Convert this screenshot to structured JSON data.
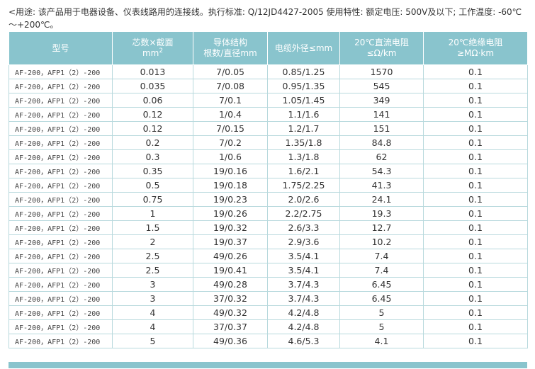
{
  "intro_text": "<用途: 该产品用于电器设备、仪表线路用的连接线。执行标准: Q/12JD4427-2005 使用特性: 额定电压: 500V及以下; 工作温度: -60℃～+200℃。",
  "table": {
    "headers": [
      {
        "line1": "型号",
        "line2": ""
      },
      {
        "line1": "芯数×截面",
        "line2": "mm",
        "sup": "2"
      },
      {
        "line1": "导体结构",
        "line2": "根数/直径mm"
      },
      {
        "line1": "电缆外径≤mm",
        "line2": ""
      },
      {
        "line1": "20℃直流电阻",
        "line2": "≤Ω/km"
      },
      {
        "line1": "20℃绝缘电阻",
        "line2": "≥MΩ·km"
      }
    ],
    "rows": [
      [
        "AF-200，AFP1（2）-200",
        "0.013",
        "7/0.05",
        "0.85/1.25",
        "1570",
        "0.1"
      ],
      [
        "AF-200，AFP1（2）-200",
        "0.035",
        "7/0.08",
        "0.95/1.35",
        "545",
        "0.1"
      ],
      [
        "AF-200，AFP1（2）-200",
        "0.06",
        "7/0.1",
        "1.05/1.45",
        "349",
        "0.1"
      ],
      [
        "AF-200，AFP1（2）-200",
        "0.12",
        "1/0.4",
        "1.1/1.6",
        "141",
        "0.1"
      ],
      [
        "AF-200，AFP1（2）-200",
        "0.12",
        "7/0.15",
        "1.2/1.7",
        "151",
        "0.1"
      ],
      [
        "AF-200，AFP1（2）-200",
        "0.2",
        "7/0.2",
        "1.35/1.8",
        "84.8",
        "0.1"
      ],
      [
        "AF-200，AFP1（2）-200",
        "0.3",
        "1/0.6",
        "1.3/1.8",
        "62",
        "0.1"
      ],
      [
        "AF-200，AFP1（2）-200",
        "0.35",
        "19/0.16",
        "1.6/2.1",
        "54.3",
        "0.1"
      ],
      [
        "AF-200，AFP1（2）-200",
        "0.5",
        "19/0.18",
        "1.75/2.25",
        "41.3",
        "0.1"
      ],
      [
        "AF-200，AFP1（2）-200",
        "0.75",
        "19/0.23",
        "2.0/2.6",
        "24.1",
        "0.1"
      ],
      [
        "AF-200，AFP1（2）-200",
        "1",
        "19/0.26",
        "2.2/2.75",
        "19.3",
        "0.1"
      ],
      [
        "AF-200，AFP1（2）-200",
        "1.5",
        "19/0.32",
        "2.6/3.3",
        "12.7",
        "0.1"
      ],
      [
        "AF-200，AFP1（2）-200",
        "2",
        "19/0.37",
        "2.9/3.6",
        "10.2",
        "0.1"
      ],
      [
        "AF-200，AFP1（2）-200",
        "2.5",
        "49/0.26",
        "3.5/4.1",
        "7.4",
        "0.1"
      ],
      [
        "AF-200，AFP1（2）-200",
        "2.5",
        "19/0.41",
        "3.5/4.1",
        "7.4",
        "0.1"
      ],
      [
        "AF-200，AFP1（2）-200",
        "3",
        "49/0.28",
        "3.7/4.3",
        "6.45",
        "0.1"
      ],
      [
        "AF-200，AFP1（2）-200",
        "3",
        "37/0.32",
        "3.7/4.3",
        "6.45",
        "0.1"
      ],
      [
        "AF-200，AFP1（2）-200",
        "4",
        "49/0.32",
        "4.2/4.8",
        "5",
        "0.1"
      ],
      [
        "AF-200，AFP1（2）-200",
        "4",
        "37/0.37",
        "4.2/4.8",
        "5",
        "0.1"
      ],
      [
        "AF-200，AFP1（2）-200",
        "5",
        "49/0.36",
        "4.6/5.3",
        "4.1",
        "0.1"
      ]
    ]
  },
  "colors": {
    "header_bg": "#89c4cd",
    "border": "#b8d9dd",
    "text": "#333333"
  }
}
